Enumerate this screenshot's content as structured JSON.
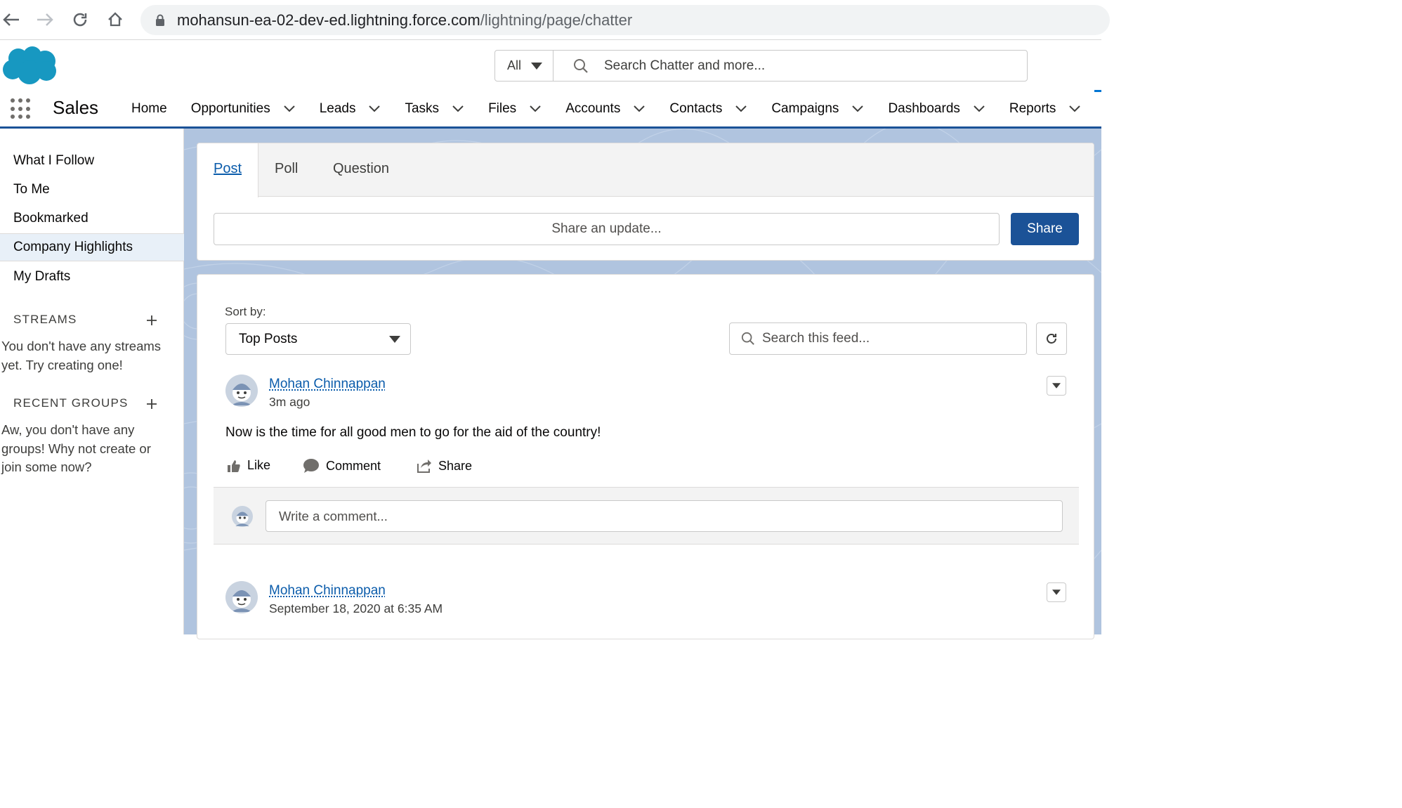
{
  "browser": {
    "url_host": "mohansun-ea-02-dev-ed.lightning.force.com",
    "url_path": "/lightning/page/chatter"
  },
  "header": {
    "search_scope": "All",
    "search_placeholder": "Search Chatter and more..."
  },
  "app_nav": {
    "app_name": "Sales",
    "items": [
      {
        "label": "Home",
        "has_menu": false
      },
      {
        "label": "Opportunities",
        "has_menu": true
      },
      {
        "label": "Leads",
        "has_menu": true
      },
      {
        "label": "Tasks",
        "has_menu": true
      },
      {
        "label": "Files",
        "has_menu": true
      },
      {
        "label": "Accounts",
        "has_menu": true
      },
      {
        "label": "Contacts",
        "has_menu": true
      },
      {
        "label": "Campaigns",
        "has_menu": true
      },
      {
        "label": "Dashboards",
        "has_menu": true
      },
      {
        "label": "Reports",
        "has_menu": true
      }
    ]
  },
  "sidebar": {
    "items": [
      {
        "label": "What I Follow"
      },
      {
        "label": "To Me"
      },
      {
        "label": "Bookmarked"
      },
      {
        "label": "Company Highlights"
      },
      {
        "label": "My Drafts"
      }
    ],
    "active_index": 3,
    "streams_title": "STREAMS",
    "streams_empty_line1": "You don't have any streams",
    "streams_empty_line2": "yet. Try creating one!",
    "groups_title": "RECENT GROUPS",
    "groups_empty_line1": "Aw, you don't have any",
    "groups_empty_line2": "groups! Why not create or",
    "groups_empty_line3": "join some now?"
  },
  "publisher": {
    "tabs": [
      "Post",
      "Poll",
      "Question"
    ],
    "active_tab": "Post",
    "input_placeholder": "Share an update...",
    "share_label": "Share"
  },
  "feed": {
    "sort_label": "Sort by:",
    "sort_value": "Top Posts",
    "search_placeholder": "Search this feed...",
    "posts": [
      {
        "author": "Mohan Chinnappan",
        "time": "3m ago",
        "body": "Now is the time for all good men to go for the aid of the country!",
        "actions": {
          "like": "Like",
          "comment": "Comment",
          "share": "Share"
        },
        "comment_placeholder": "Write a comment..."
      },
      {
        "author": "Mohan Chinnappan",
        "time": "September 18, 2020 at 6:35 AM"
      }
    ]
  },
  "colors": {
    "brand_blue": "#1b5297",
    "link_blue": "#0b5cab",
    "cloud_blue": "#1798c1"
  }
}
